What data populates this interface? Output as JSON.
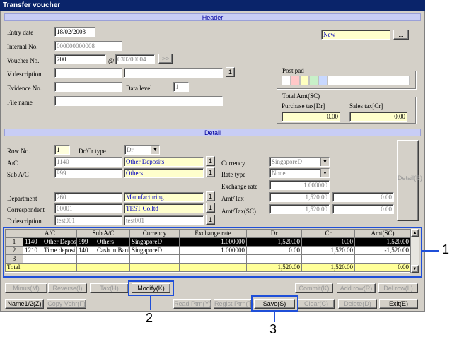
{
  "window": {
    "title": "Transfer voucher"
  },
  "header": {
    "section_label": "Header",
    "entry_date_label": "Entry date",
    "entry_date": "18/02/2003",
    "internal_no_label": "Internal No.",
    "internal_no": "000000000008",
    "voucher_no_label": "Voucher No.",
    "voucher_prefix": "700",
    "voucher_at": "@",
    "voucher_no": "030200004",
    "voucher_next": ">>",
    "v_description_label": "V description",
    "v_desc_btn": "1",
    "evidence_no_label": "Evidence No.",
    "data_level_label": "Data level",
    "data_level": "1",
    "file_name_label": "File name",
    "status": "New",
    "status_btn": "...",
    "post_pad_label": "Post pad",
    "post_pad_colors": [
      "#ffffff",
      "#ffc8c8",
      "#ffffc0",
      "#c8f0c8",
      "#c8d8ff",
      "#ffffff"
    ],
    "total_amt_label": "Total Amt(SC)",
    "purchase_tax_label": "Purchase tax[Dr]",
    "purchase_tax": "0.00",
    "sales_tax_label": "Sales tax[Cr]",
    "sales_tax": "0.00"
  },
  "detail": {
    "section_label": "Detail",
    "row_no_label": "Row No.",
    "row_no": "1",
    "drcr_label": "Dr/Cr type",
    "drcr_value": "Dr",
    "ac_label": "A/C",
    "ac_code": "1140",
    "ac_name": "Other Deposits",
    "sub_ac_label": "Sub A/C",
    "sub_ac_code": "999",
    "sub_ac_name": "Others",
    "department_label": "Department",
    "dept_code": "260",
    "dept_name": "Manufacturing",
    "correspondent_label": "Correspondent",
    "corr_code": "00001",
    "corr_name": "TEST Co.ltd",
    "d_description_label": "D description",
    "d_desc1": "test001",
    "d_desc2": "test001",
    "one_btn": "1",
    "currency_label": "Currency",
    "currency": "SingaporeD",
    "rate_type_label": "Rate type",
    "rate_type": "None",
    "exchange_rate_label": "Exchange rate",
    "exchange_rate": "1.000000",
    "amt_tax_label": "Amt/Tax",
    "amt": "1,520.00",
    "tax": "0.00",
    "amt_tax_sc_label": "Amt/Tax(SC)",
    "amt_sc": "1,520.00",
    "tax_sc": "0.00",
    "detail_btn": "Detail(B)"
  },
  "grid": {
    "columns": [
      "",
      "A/C",
      "Sub A/C",
      "Currency",
      "Exchange rate",
      "Dr",
      "Cr",
      "Amt(SC)"
    ],
    "rows": [
      [
        "1",
        "1140",
        "Other Depos",
        "999",
        "Others",
        "SingaporeD",
        "1.000000",
        "1,520.00",
        "0.00",
        "1,520.00"
      ],
      [
        "2",
        "1210",
        "Time deposit",
        "140",
        "Cash in Bank",
        "SingaporeD",
        "1.000000",
        "0.00",
        "1,520.00",
        "-1,520.00"
      ],
      [
        "3",
        "",
        "",
        "",
        "",
        "",
        "",
        "",
        "",
        ""
      ]
    ],
    "total": {
      "label": "Total",
      "dr": "1,520.00",
      "cr": "1,520.00",
      "amt": "0.00"
    }
  },
  "buttons_row1": {
    "minus": "Minus(M)",
    "reverse": "Reverse(I)",
    "tax": "Tax(H)",
    "modify": "Modify(K)",
    "commit": "Commit(K)",
    "add_row": "Add row(R)",
    "del_row": "Del row(L)"
  },
  "buttons_row2": {
    "name12": "Name1/2(Z)",
    "copy_vchr": "Copy Vchr(F)",
    "read_ptrn": "Read Ptrn(Y)",
    "regist_ptrn": "Regist Ptrn(T)",
    "save": "Save(S)",
    "clear": "Clear(C)",
    "delete": "Delete(D)",
    "exit": "Exit(E)"
  },
  "callouts": {
    "one": "1",
    "two": "2",
    "three": "3"
  },
  "colors": {
    "callout_blue": "#1f4fd8",
    "title_bar": "#0a246a",
    "section_bar": "#c8cdf5",
    "total_row": "#ffff99"
  }
}
